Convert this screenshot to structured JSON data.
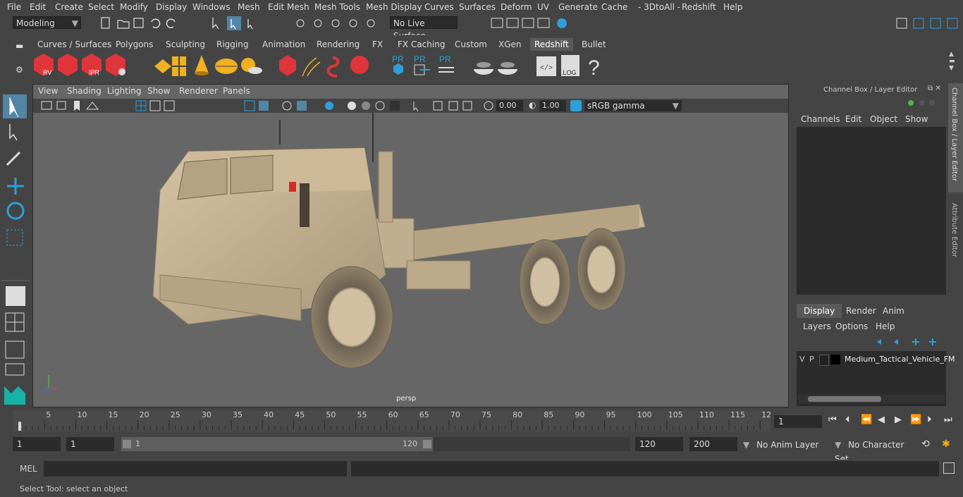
{
  "menubar": [
    "File",
    "Edit",
    "Create",
    "Select",
    "Modify",
    "Display",
    "Windows",
    "Mesh",
    "Edit Mesh",
    "Mesh Tools",
    "Mesh Display",
    "Curves",
    "Surfaces",
    "Deform",
    "UV",
    "Generate",
    "Cache",
    "- 3DtoAll -",
    "Redshift",
    "Help"
  ],
  "toolbar": {
    "mode": "Modeling",
    "live_surface": "No Live Surface"
  },
  "shelf_tabs": [
    "Curves / Surfaces",
    "Polygons",
    "Sculpting",
    "Rigging",
    "Animation",
    "Rendering",
    "FX",
    "FX Caching",
    "Custom",
    "XGen",
    "Redshift",
    "Bullet"
  ],
  "shelf_active": "Redshift",
  "shelf_labels": {
    "rv": "RV",
    "ipr": "IPR",
    "pr": "PR",
    "log": ".LOG",
    "help": "?"
  },
  "viewport": {
    "menus": [
      "View",
      "Shading",
      "Lighting",
      "Show",
      "Renderer",
      "Panels"
    ],
    "exposure": "0.00",
    "gamma": "1.00",
    "color_space": "sRGB gamma",
    "camera": "persp"
  },
  "right_panel": {
    "title": "Channel Box / Layer Editor",
    "channel_menus": [
      "Channels",
      "Edit",
      "Object",
      "Show"
    ],
    "side_tabs": [
      "Channel Box / Layer Editor",
      "Attribute Editor"
    ],
    "layer_tabs": [
      "Display",
      "Render",
      "Anim"
    ],
    "layer_menus": [
      "Layers",
      "Options",
      "Help"
    ],
    "layer_row": {
      "v": "V",
      "p": "P",
      "name": "Medium_Tactical_Vehicle_FM"
    }
  },
  "timeline": {
    "ticks": [
      "5",
      "10",
      "15",
      "20",
      "25",
      "30",
      "35",
      "40",
      "45",
      "50",
      "55",
      "60",
      "65",
      "70",
      "75",
      "80",
      "85",
      "90",
      "95",
      "100",
      "105",
      "110",
      "115",
      "12"
    ],
    "start_label": "1",
    "current_frame": "1"
  },
  "range": {
    "start": "1",
    "start2": "1",
    "slider_start": "1",
    "slider_end": "120",
    "end": "120",
    "end2": "200",
    "anim_layer": "No Anim Layer",
    "char_set": "No Character Set"
  },
  "cmd": {
    "lang": "MEL"
  },
  "status": "Select Tool: select an object",
  "colors": {
    "bg": "#444444",
    "viewport": "#666666",
    "field": "#2b2b2b",
    "accent": "#5285a6",
    "redshift": "#e0353a",
    "amber": "#f0b020",
    "blue": "#2e9fd8"
  }
}
